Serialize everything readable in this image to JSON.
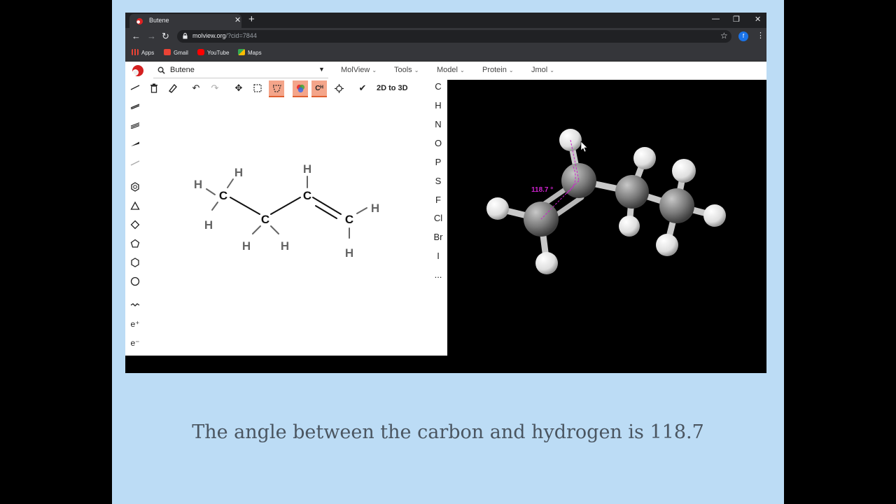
{
  "browser": {
    "tab_title": "Butene",
    "url_host": "molview.org",
    "url_path": "/?cid=7844",
    "profile_initial": "f",
    "bookmarks": [
      "Apps",
      "Gmail",
      "YouTube",
      "Maps"
    ]
  },
  "app": {
    "search_value": "Butene",
    "menus": [
      "MolView",
      "Tools",
      "Model",
      "Protein",
      "Jmol"
    ],
    "convert_label": "2D to 3D",
    "elements": [
      "C",
      "H",
      "N",
      "O",
      "P",
      "S",
      "F",
      "Cl",
      "Br",
      "I",
      "..."
    ],
    "charges": [
      "e⁺",
      "e⁻"
    ]
  },
  "molecule_2d": {
    "carbon_label": "C",
    "hydrogen_label": "H"
  },
  "viewer": {
    "angle_label": "118.7 °"
  },
  "caption": "The angle between the carbon and hydrogen is 118.7",
  "colors": {
    "slide_background": "#bcdcf5",
    "active_tool": "#f4a58a",
    "angle_measure": "#cc22cc",
    "carbon_atom": "#8a8a8a",
    "hydrogen_atom": "#f2f2f2"
  }
}
